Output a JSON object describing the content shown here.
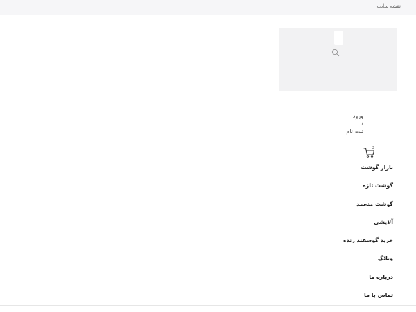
{
  "topbar": {
    "sitemap_label": "نقشه سایت"
  },
  "search": {
    "icon": "search-icon"
  },
  "auth": {
    "login_label": "ورود",
    "separator": "/",
    "register_label": "ثبت نام"
  },
  "cart": {
    "icon": "cart-icon",
    "count": "0"
  },
  "nav": {
    "items": [
      {
        "label": "بازار گوشت"
      },
      {
        "label": "گوشت تازه"
      },
      {
        "label": "گوشت منجمد"
      },
      {
        "label": "آلایشی"
      },
      {
        "label": "خرید گوسفند زنده"
      },
      {
        "label": "وبلاگ"
      },
      {
        "label": "درباره ما"
      },
      {
        "label": "تماس با ما"
      }
    ]
  }
}
